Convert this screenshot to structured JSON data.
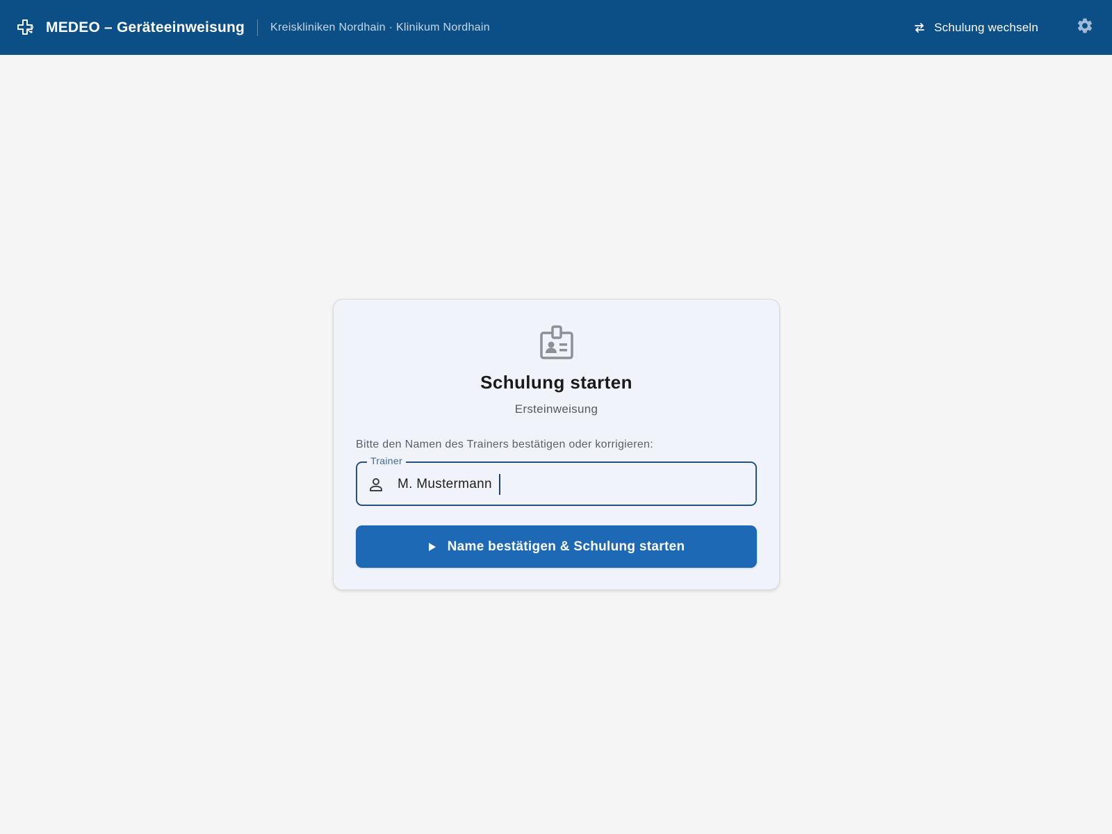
{
  "header": {
    "app_icon": "medical-cross-circuit-icon",
    "title": "MEDEO – Geräteeinweisung",
    "location": "Kreiskliniken Nordhain · Klinikum Nordhain",
    "switch_label": "Schulung wechseln",
    "switch_icon": "swap-arrows-icon",
    "settings_icon": "gear-icon"
  },
  "card": {
    "icon": "id-badge-icon",
    "title": "Schulung starten",
    "subtitle": "Ersteinweisung",
    "instruction": "Bitte den Namen des Trainers bestätigen oder korrigieren:",
    "trainer_field": {
      "label": "Trainer",
      "value": "M. Mustermann",
      "icon": "person-icon"
    },
    "start_button": {
      "label": "Name bestätigen & Schulung starten",
      "icon": "play-icon"
    }
  },
  "colors": {
    "header_bg": "#0c4f87",
    "page_bg": "#f5f5f5",
    "card_bg": "#f1f3fa",
    "primary": "#1d69b6",
    "field_border": "#24517f"
  }
}
